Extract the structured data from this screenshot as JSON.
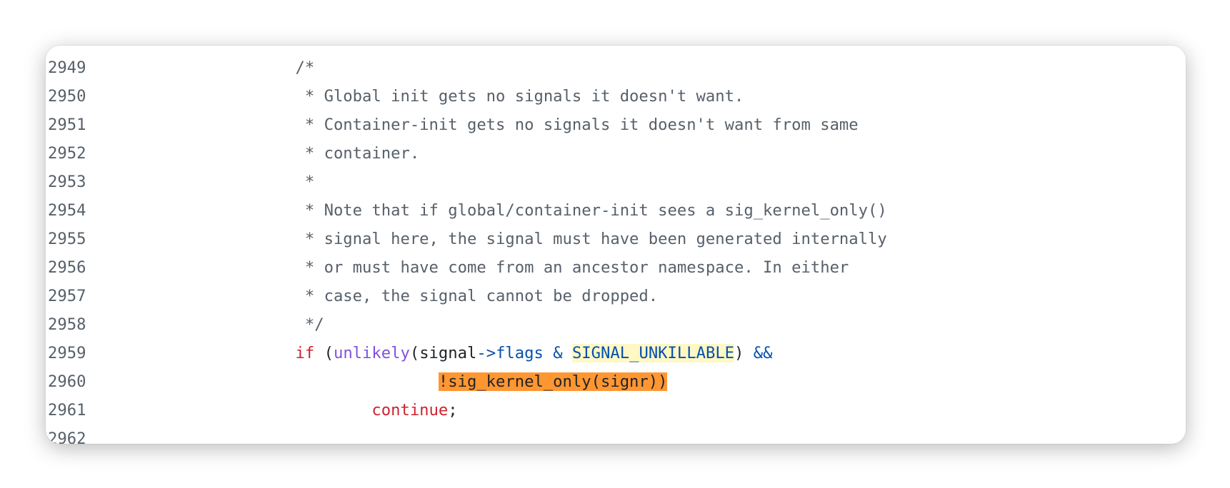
{
  "lines": [
    {
      "num": "2949",
      "tokens": [
        {
          "t": "                     /*",
          "c": "cm"
        }
      ]
    },
    {
      "num": "2950",
      "tokens": [
        {
          "t": "                      * Global init gets no signals it doesn't want.",
          "c": "cm"
        }
      ]
    },
    {
      "num": "2951",
      "tokens": [
        {
          "t": "                      * Container-init gets no signals it doesn't want from same",
          "c": "cm"
        }
      ]
    },
    {
      "num": "2952",
      "tokens": [
        {
          "t": "                      * container.",
          "c": "cm"
        }
      ]
    },
    {
      "num": "2953",
      "tokens": [
        {
          "t": "                      *",
          "c": "cm"
        }
      ]
    },
    {
      "num": "2954",
      "tokens": [
        {
          "t": "                      * Note that if global/container-init sees a sig_kernel_only()",
          "c": "cm"
        }
      ]
    },
    {
      "num": "2955",
      "tokens": [
        {
          "t": "                      * signal here, the signal must have been generated internally",
          "c": "cm"
        }
      ]
    },
    {
      "num": "2956",
      "tokens": [
        {
          "t": "                      * or must have come from an ancestor namespace. In either",
          "c": "cm"
        }
      ]
    },
    {
      "num": "2957",
      "tokens": [
        {
          "t": "                      * case, the signal cannot be dropped.",
          "c": "cm"
        }
      ]
    },
    {
      "num": "2958",
      "tokens": [
        {
          "t": "                      */",
          "c": "cm"
        }
      ]
    },
    {
      "num": "2959",
      "tokens": [
        {
          "t": "                     ",
          "c": "id"
        },
        {
          "t": "if",
          "c": "kw"
        },
        {
          "t": " (",
          "c": "id"
        },
        {
          "t": "unlikely",
          "c": "fn"
        },
        {
          "t": "(signal",
          "c": "id"
        },
        {
          "t": "->",
          "c": "op"
        },
        {
          "t": "flags",
          "c": "op"
        },
        {
          "t": " & ",
          "c": "op"
        },
        {
          "t": "SIGNAL_UNKILLABLE",
          "c": "op hl1"
        },
        {
          "t": ") ",
          "c": "id"
        },
        {
          "t": "&&",
          "c": "op"
        }
      ]
    },
    {
      "num": "2960",
      "tokens": [
        {
          "t": "                                    ",
          "c": "id"
        },
        {
          "t": "!sig_kernel_only(signr))",
          "c": "hl2"
        }
      ]
    },
    {
      "num": "2961",
      "tokens": [
        {
          "t": "                             ",
          "c": "id"
        },
        {
          "t": "continue",
          "c": "kw"
        },
        {
          "t": ";",
          "c": "id"
        }
      ]
    },
    {
      "num": "2962",
      "tokens": []
    }
  ]
}
